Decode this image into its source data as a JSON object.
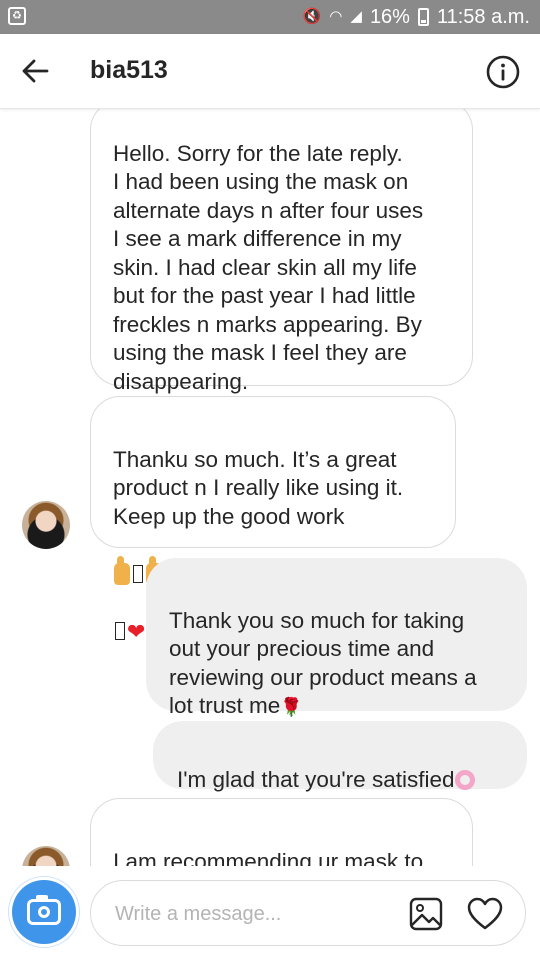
{
  "status_bar": {
    "battery": "16%",
    "time": "11:58 a.m."
  },
  "header": {
    "username": "bia513"
  },
  "messages": [
    {
      "direction": "incoming",
      "text": "Hello. Sorry for the late reply.\nI had been using the mask on\nalternate days n after four uses\nI see a mark difference in my\nskin. I had clear skin all my life\nbut for the past year I had little\nfreckles n marks appearing. By\nusing the mask I feel they are\ndisappearing."
    },
    {
      "direction": "incoming",
      "text": "Thanku so much. It’s a great\nproduct n I really like using it.\nKeep up the good work"
    },
    {
      "direction": "outgoing",
      "text": "Thank you so much for taking\nout your precious time and\nreviewing our product means a\nlot trust me"
    },
    {
      "direction": "outgoing",
      "text": "I'm glad that you're satisfied"
    },
    {
      "direction": "incoming",
      "text": "I am recommending ur mask to\nall my friends"
    }
  ],
  "composer": {
    "placeholder": "Write a message..."
  },
  "icons": {
    "back": "arrow-left-icon",
    "info": "info-icon",
    "camera": "camera-icon",
    "gallery": "gallery-icon",
    "like": "heart-icon"
  },
  "colors": {
    "status_bar": "#8a8a8a",
    "camera_button": "#3f95ea",
    "incoming_bubble_border": "#dbdbdb",
    "outgoing_bubble_bg": "#efefef",
    "text": "#262626"
  }
}
